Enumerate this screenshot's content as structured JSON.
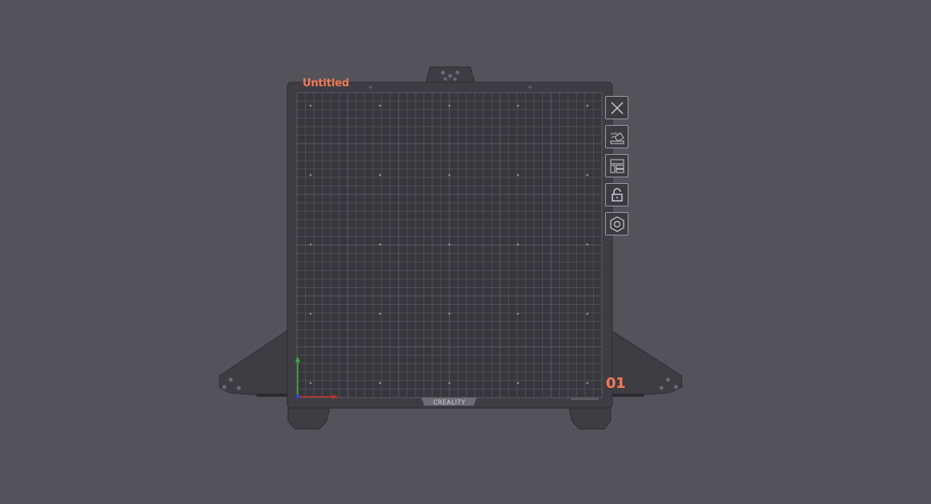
{
  "plate": {
    "name": "Untitled",
    "index": "01",
    "brand": "CREALITY"
  },
  "toolbar": {
    "items": [
      {
        "id": "close",
        "icon": "close-icon"
      },
      {
        "id": "auto-orient",
        "icon": "auto-orient-icon"
      },
      {
        "id": "arrange",
        "icon": "arrange-icon"
      },
      {
        "id": "lock",
        "icon": "unlock-icon"
      },
      {
        "id": "settings",
        "icon": "hex-settings-icon"
      }
    ]
  },
  "colors": {
    "background": "#545359",
    "plate": "#3c3b40",
    "bed": "#38373c",
    "accent": "#f07a55",
    "x_axis": "#c0312b",
    "y_axis": "#3fae3c",
    "z_axis": "#2c45c8"
  }
}
